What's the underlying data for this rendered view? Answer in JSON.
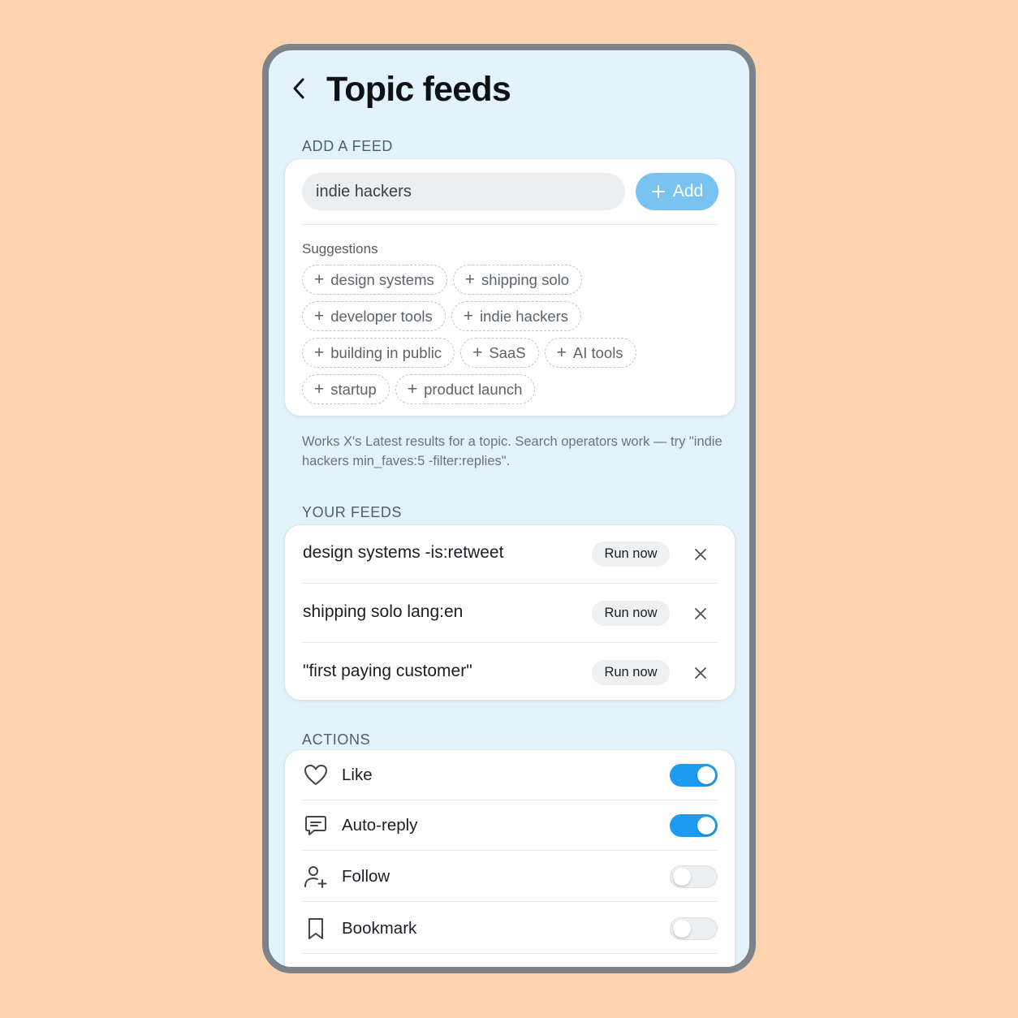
{
  "header": {
    "title": "Topic feeds"
  },
  "add_feed": {
    "section_label": "ADD A FEED",
    "input_value": "indie hackers",
    "add_label": "Add",
    "suggestions_label": "Suggestions",
    "suggestions": [
      [
        "design systems",
        "shipping solo"
      ],
      [
        "developer tools",
        "indie hackers"
      ],
      [
        "building in public",
        "SaaS",
        "AI tools"
      ],
      [
        "startup",
        "product launch"
      ]
    ],
    "helper_text": "Works X's Latest results for a topic. Search operators work — try \"indie hackers min_faves:5 -filter:replies\"."
  },
  "your_feeds": {
    "section_label": "YOUR FEEDS",
    "run_label": "Run now",
    "items": [
      {
        "query": "design systems -is:retweet"
      },
      {
        "query": "shipping solo lang:en"
      },
      {
        "query": "\"first paying customer\""
      }
    ]
  },
  "actions": {
    "section_label": "ACTIONS",
    "items": [
      {
        "label": "Like",
        "icon": "heart-icon",
        "enabled": true
      },
      {
        "label": "Auto-reply",
        "icon": "chat-icon",
        "enabled": true
      },
      {
        "label": "Follow",
        "icon": "user-plus-icon",
        "enabled": false
      },
      {
        "label": "Bookmark",
        "icon": "bookmark-icon",
        "enabled": false
      }
    ]
  },
  "colors": {
    "accent": "#1d9bf0",
    "add_button": "#79c3f1",
    "screen_bg": "#e3f3fb",
    "page_bg": "#fed3b0"
  }
}
